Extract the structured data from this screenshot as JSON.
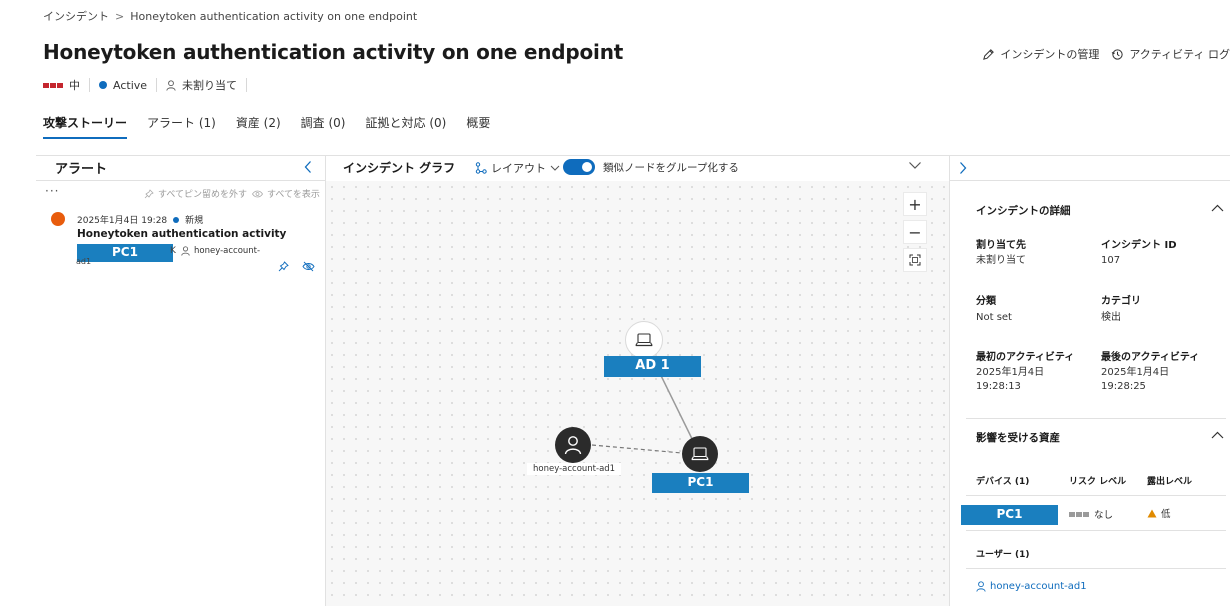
{
  "breadcrumb": {
    "root": "インシデント",
    "current": "Honeytoken authentication activity on one endpoint"
  },
  "title": "Honeytoken authentication activity on one endpoint",
  "actions": {
    "manage": "インシデントの管理",
    "activity_log": "アクティビティ ログ"
  },
  "meta": {
    "severity": "中",
    "status": "Active",
    "assignee": "未割り当て"
  },
  "tabs": [
    "攻撃ストーリー",
    "アラート (1)",
    "資産 (2)",
    "調査 (0)",
    "証拠と対応 (0)",
    "概要"
  ],
  "alerts_pane": {
    "title": "アラート",
    "more": "···",
    "unpin_all": "すべてピン留めを外す",
    "show_all": "すべてを表示",
    "alert": {
      "time": "2025年1月4日 19:28",
      "status": "新規",
      "title": "Honeytoken authentication activity",
      "device": "PC1",
      "account": "honey-account-",
      "account_tail": "ad1",
      "separator": "K"
    }
  },
  "graph": {
    "title": "インシデント グラフ",
    "layout": "レイアウト",
    "group_label": "類似ノードをグループ化する",
    "group_enabled": true,
    "zoom_in": "+",
    "zoom_out": "−",
    "nodes": {
      "ad": "AD 1",
      "pc": "PC1",
      "user": "honey-account-ad1"
    }
  },
  "details": {
    "section_title": "インシデントの詳細",
    "assigned_to_label": "割り当て先",
    "assigned_to": "未割り当て",
    "incident_id_label": "インシデント ID",
    "incident_id": "107",
    "classification_label": "分類",
    "classification": "Not set",
    "category_label": "カテゴリ",
    "category": "検出",
    "first_activity_label": "最初のアクティビティ",
    "first_activity_date": "2025年1月4日",
    "first_activity_time": "19:28:13",
    "last_activity_label": "最後のアクティビティ",
    "last_activity_date": "2025年1月4日",
    "last_activity_time": "19:28:25"
  },
  "assets": {
    "section_title": "影響を受ける資産",
    "devices_head": "デバイス (1)",
    "risk_head": "リスク レベル",
    "exposure_head": "露出レベル",
    "device_name": "PC1",
    "risk": "なし",
    "exposure": "低",
    "users_head": "ユーザー (1)",
    "user_name": "honey-account-ad1"
  },
  "colors": {
    "accent": "#0f6cbd",
    "severity_medium": "#c4262e",
    "alert_orange": "#e85c0d",
    "redaction": "#1a7fbf",
    "exposure_low": "#e08a00"
  }
}
